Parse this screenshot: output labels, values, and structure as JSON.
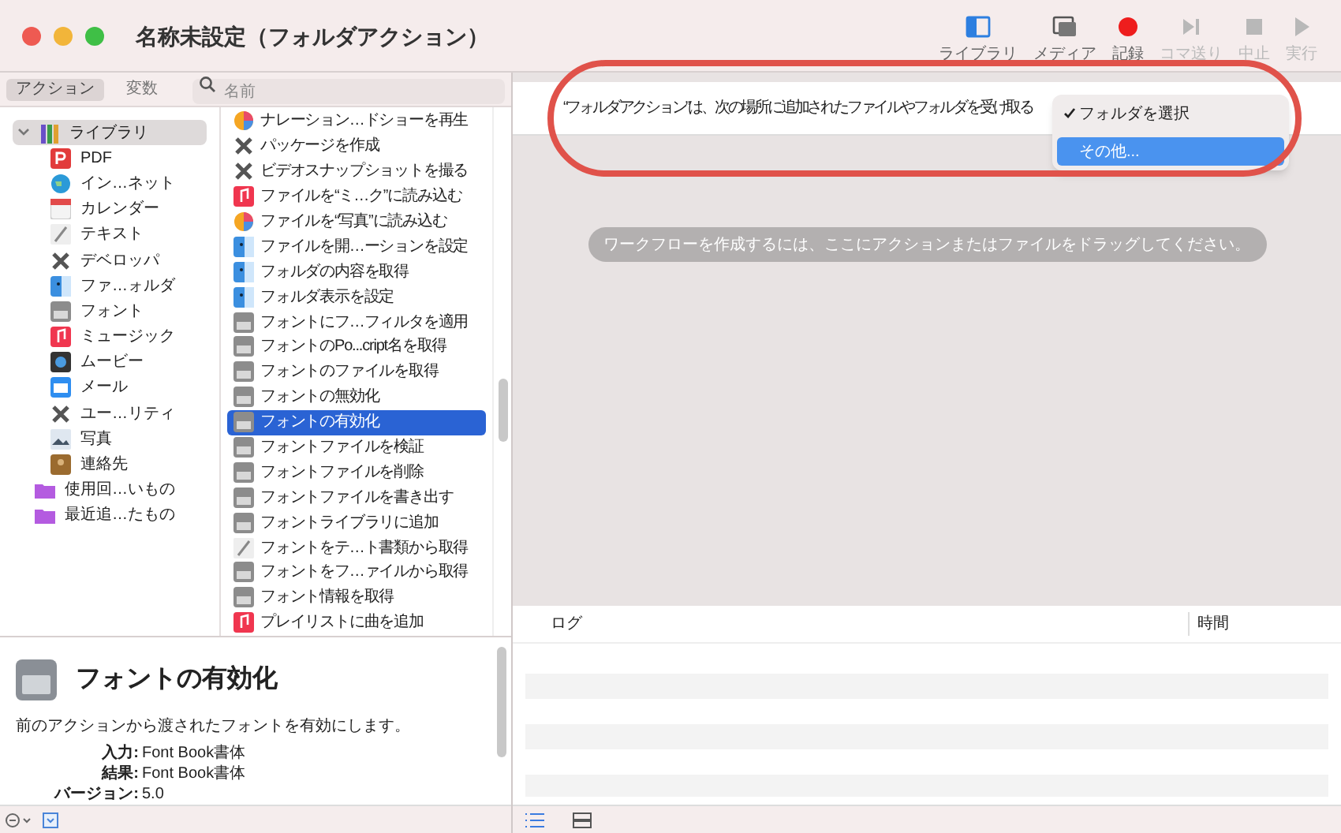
{
  "window": {
    "title": "名称未設定（フォルダアクション）"
  },
  "toolbar": [
    {
      "label": "ライブラリ",
      "kind": "library",
      "disabled": false
    },
    {
      "label": "メディア",
      "kind": "media",
      "disabled": false
    },
    {
      "label": "記録",
      "kind": "record",
      "disabled": false
    },
    {
      "label": "コマ送り",
      "kind": "step",
      "disabled": true
    },
    {
      "label": "中止",
      "kind": "stop",
      "disabled": true
    },
    {
      "label": "実行",
      "kind": "run",
      "disabled": true
    }
  ],
  "tabs": [
    {
      "label": "アクション",
      "selected": true
    },
    {
      "label": "変数",
      "selected": false
    }
  ],
  "search": {
    "placeholder": "名前"
  },
  "library": {
    "label": "ライブラリ",
    "expanded": true,
    "selected": true,
    "children": [
      {
        "label": "PDF",
        "kind": "pdf"
      },
      {
        "label": "イン…ネット",
        "kind": "globe"
      },
      {
        "label": "カレンダー",
        "kind": "calendar"
      },
      {
        "label": "テキスト",
        "kind": "text"
      },
      {
        "label": "デベロッパ",
        "kind": "tools"
      },
      {
        "label": "ファ…ォルダ",
        "kind": "finder"
      },
      {
        "label": "フォント",
        "kind": "font"
      },
      {
        "label": "ミュージック",
        "kind": "music"
      },
      {
        "label": "ムービー",
        "kind": "movie"
      },
      {
        "label": "メール",
        "kind": "mail"
      },
      {
        "label": "ユー…リティ",
        "kind": "tools"
      },
      {
        "label": "写真",
        "kind": "photo"
      },
      {
        "label": "連絡先",
        "kind": "contacts"
      }
    ]
  },
  "smart_folders": [
    {
      "label": "使用回…いもの",
      "kind": "folder"
    },
    {
      "label": "最近追…たもの",
      "kind": "folder"
    }
  ],
  "actions": [
    {
      "label": "ナレーション…ドショーを再生",
      "kind": "colorwheel",
      "selected": false
    },
    {
      "label": "パッケージを作成",
      "kind": "tools",
      "selected": false
    },
    {
      "label": "ビデオスナップショットを撮る",
      "kind": "tools",
      "selected": false
    },
    {
      "label": "ファイルを“ミ…ク”に読み込む",
      "kind": "music",
      "selected": false
    },
    {
      "label": "ファイルを“写真”に読み込む",
      "kind": "colorwheel",
      "selected": false
    },
    {
      "label": "ファイルを開…ーションを設定",
      "kind": "finder",
      "selected": false
    },
    {
      "label": "フォルダの内容を取得",
      "kind": "finder",
      "selected": false
    },
    {
      "label": "フォルダ表示を設定",
      "kind": "finder",
      "selected": false
    },
    {
      "label": "フォントにフ…フィルタを適用",
      "kind": "font",
      "selected": false
    },
    {
      "label": "フォントのPo...cript名を取得",
      "kind": "font",
      "selected": false
    },
    {
      "label": "フォントのファイルを取得",
      "kind": "font",
      "selected": false
    },
    {
      "label": "フォントの無効化",
      "kind": "font",
      "selected": false
    },
    {
      "label": "フォントの有効化",
      "kind": "font",
      "selected": true
    },
    {
      "label": "フォントファイルを検証",
      "kind": "font",
      "selected": false
    },
    {
      "label": "フォントファイルを削除",
      "kind": "font",
      "selected": false
    },
    {
      "label": "フォントファイルを書き出す",
      "kind": "font",
      "selected": false
    },
    {
      "label": "フォントライブラリに追加",
      "kind": "font",
      "selected": false
    },
    {
      "label": "フォントをテ…ト書類から取得",
      "kind": "text",
      "selected": false
    },
    {
      "label": "フォントをフ…ァイルから取得",
      "kind": "font",
      "selected": false
    },
    {
      "label": "フォント情報を取得",
      "kind": "font",
      "selected": false
    },
    {
      "label": "プレイリストに曲を追加",
      "kind": "music",
      "selected": false
    }
  ],
  "description": {
    "title": "フォントの有効化",
    "text": "前のアクションから渡されたフォントを有効にします。",
    "fields": [
      {
        "label": "入力:",
        "value": "Font Book書体"
      },
      {
        "label": "結果:",
        "value": "Font Book書体"
      },
      {
        "label": "バージョン:",
        "value": "5.0"
      }
    ]
  },
  "workflow": {
    "header": "“フォルダアクション”は、次の場所に追加されたファイルやフォルダを受け取る",
    "menu": [
      {
        "label": "フォルダを選択",
        "checked": true,
        "selected": false
      },
      {
        "label": "その他...",
        "checked": false,
        "selected": true
      }
    ],
    "hint": "ワークフローを作成するには、ここにアクションまたはファイルをドラッグしてください。"
  },
  "log": {
    "columns": [
      "ログ",
      "時間"
    ]
  }
}
